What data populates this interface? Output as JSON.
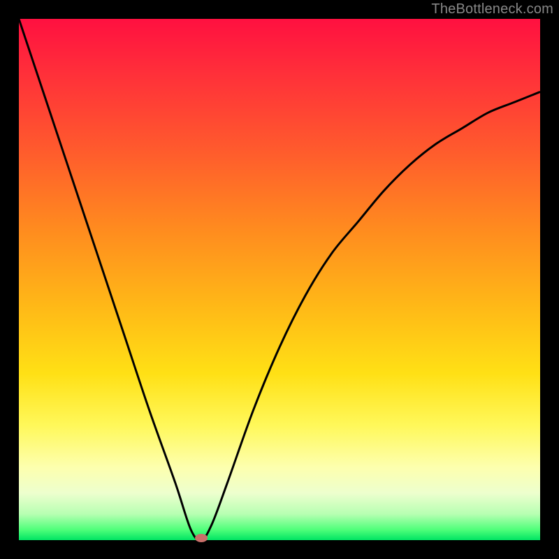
{
  "attribution": "TheBottleneck.com",
  "chart_data": {
    "type": "line",
    "title": "",
    "xlabel": "",
    "ylabel": "",
    "xlim": [
      0,
      100
    ],
    "ylim": [
      0,
      100
    ],
    "x": [
      0,
      5,
      10,
      15,
      20,
      25,
      30,
      33,
      35,
      37,
      40,
      45,
      50,
      55,
      60,
      65,
      70,
      75,
      80,
      85,
      90,
      95,
      100
    ],
    "values": [
      100,
      85,
      70,
      55,
      40,
      25,
      11,
      2,
      0,
      3,
      11,
      25,
      37,
      47,
      55,
      61,
      67,
      72,
      76,
      79,
      82,
      84,
      86
    ],
    "minimum_marker": {
      "x": 35,
      "y": 0
    },
    "colors": {
      "top": "#ff1040",
      "mid": "#ffe015",
      "bottom": "#00e463",
      "curve": "#000000",
      "marker": "#c96f6a",
      "frame": "#000000"
    }
  }
}
